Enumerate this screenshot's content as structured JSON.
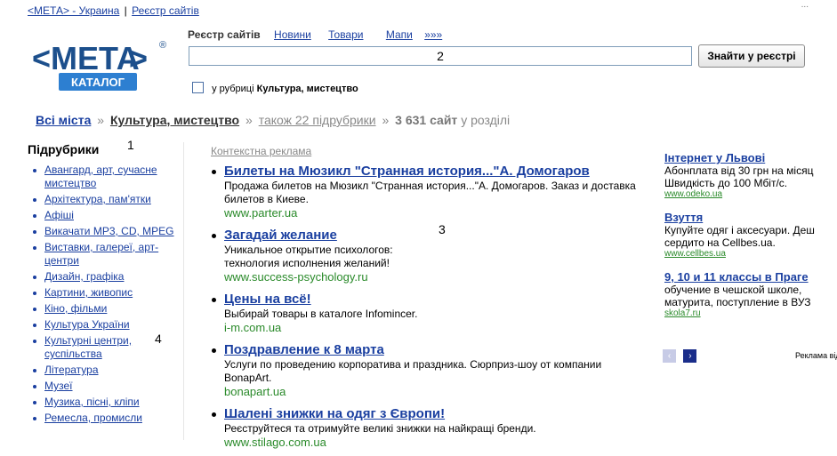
{
  "topbar": {
    "site_link": "<МЕТА> - Украина",
    "separator": "|",
    "registry_link": "Реєстр сайтів",
    "close": "..."
  },
  "logo": {
    "main": "<МЕТА",
    "registered": "®",
    "sub": "КАТАЛОГ"
  },
  "registry": {
    "title": "Реєстр сайтів",
    "links": [
      "Новини",
      "Товари",
      "Мапи",
      "»»»"
    ],
    "search_value": "2",
    "search_button": "Знайти у реєстрі",
    "checkbox_prefix": "у рубриці",
    "checkbox_rubric": "Культура, мистецтво"
  },
  "breadcrumb": {
    "all_cities": "Всі міста",
    "sep": "»",
    "rubric": "Культура, мистецтво",
    "also": "також 22 підрубрики",
    "count": "3 631 сайт",
    "suffix": "у розділі"
  },
  "markers": [
    "1",
    "2",
    "3",
    "4"
  ],
  "subrubrics": {
    "title": "Підрубрики",
    "items": [
      "Авангард, арт, сучасне мистецтво",
      "Архітектура, пам'ятки",
      "Афіші",
      "Викачати MP3, CD, MPEG",
      "Виставки, галереї, арт-центри",
      "Дизайн, графіка",
      "Картини, живопис",
      "Кіно, фільми",
      "Культура України",
      "Культурні центри, суспільства",
      "Література",
      "Музеї",
      "Музика, пісні, кліпи",
      "Ремесла, промисли"
    ]
  },
  "context_ads": {
    "title": "Контекстна реклама",
    "items": [
      {
        "title": "Билеты на Мюзикл \"Странная история...\"А. Домогаров",
        "desc": "Продажа билетов на Мюзикл \"Странная история...\"А. Домогаров. Заказ и доставка билетов в Киеве.",
        "url": "www.parter.ua"
      },
      {
        "title": "Загадай желание",
        "desc": "Уникальное открытие психологов: технология исполнения желаний!",
        "url": "www.success-psychology.ru"
      },
      {
        "title": "Цены на всё!",
        "desc": "Выбирай товары в каталоге Infomincer.",
        "url": "i-m.com.ua"
      },
      {
        "title": "Поздравление к 8 марта",
        "desc": "Услуги по проведению корпоратива и праздника. Сюрприз-шоу от компании BonapArt.",
        "url": "bonapart.ua"
      },
      {
        "title": "Шалені знижки на одяг з Європи!",
        "desc": "Реєструйтеся та отримуйте великі знижки на найкращі бренди.",
        "url": "www.stilago.com.ua"
      }
    ]
  },
  "right_ads": {
    "items": [
      {
        "title": "Інтернет у Львові",
        "desc": [
          "Абонплата від 30 грн на місяц",
          "Швидкість до 100 Мбіт/с."
        ],
        "url": "www.odeko.ua"
      },
      {
        "title": "Взуття",
        "desc": [
          "Купуйте одяг і аксесуари. Деш",
          "сердито на Cellbes.ua."
        ],
        "url": "www.cellbes.ua"
      },
      {
        "title": "9, 10 и 11 классы в Праге",
        "desc": [
          "обучение в чешской школе,",
          "матурита, поступление в ВУЗ"
        ],
        "url": "skola7.ru"
      }
    ],
    "prev": "‹",
    "next": "›",
    "credit": "Реклама від"
  }
}
